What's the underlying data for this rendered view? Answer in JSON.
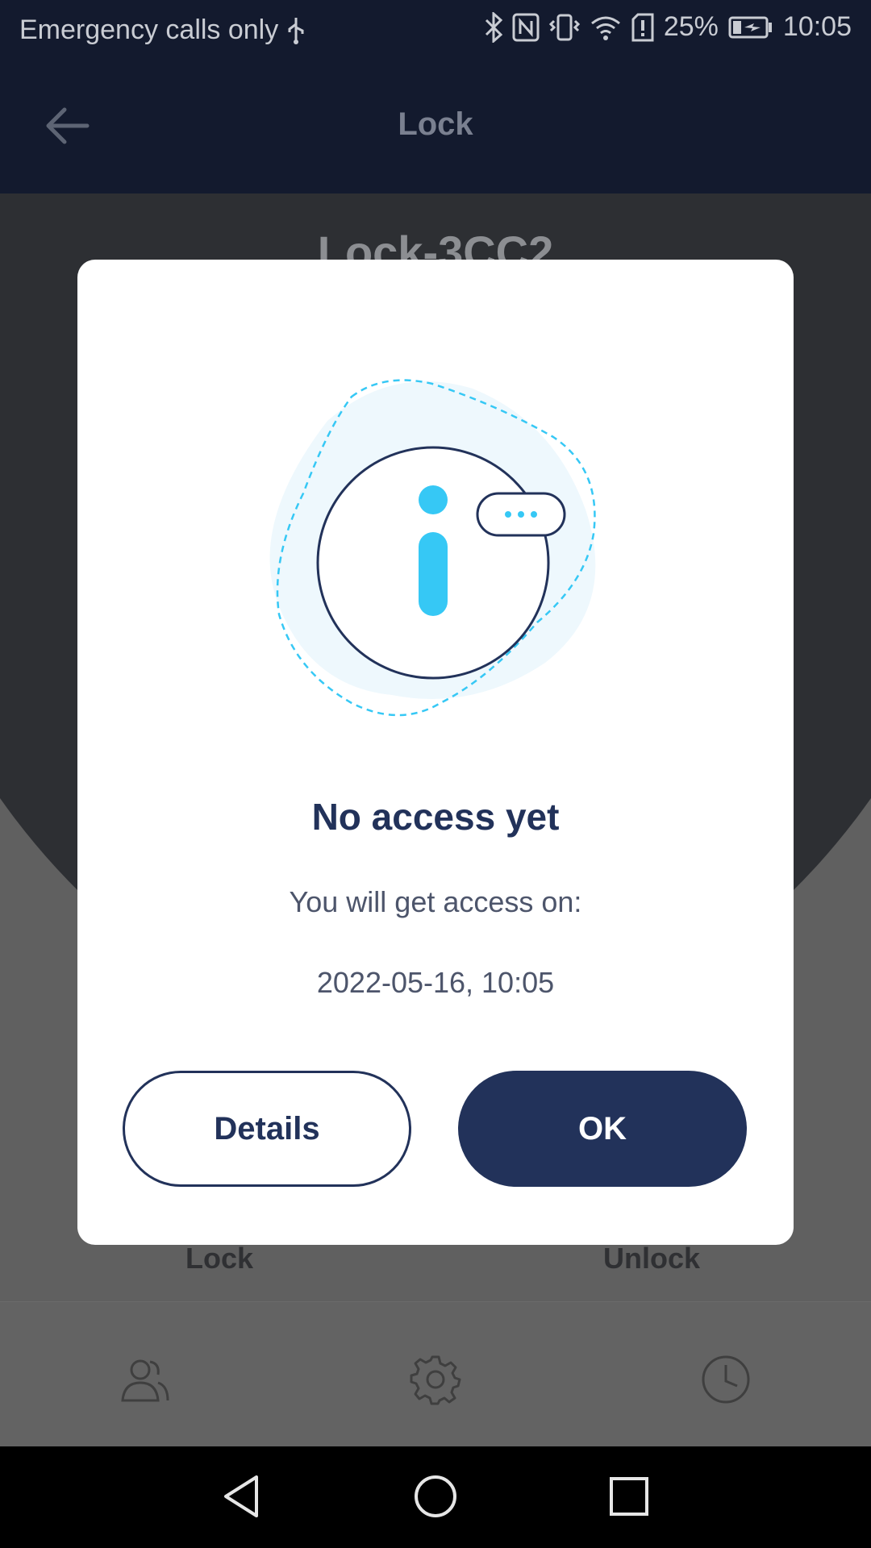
{
  "status_bar": {
    "carrier": "Emergency calls only",
    "battery": "25%",
    "time": "10:05"
  },
  "header": {
    "title": "Lock"
  },
  "background": {
    "lock_name": "Lock-3CC2",
    "lock_action": "Lock",
    "unlock_action": "Unlock"
  },
  "dialog": {
    "title": "No access yet",
    "subtitle": "You will get access on:",
    "date": "2022-05-16, 10:05",
    "details_button": "Details",
    "ok_button": "OK"
  },
  "colors": {
    "primary": "#22325a",
    "accent": "#36c8f5",
    "dialog_bg": "#ffffff"
  }
}
